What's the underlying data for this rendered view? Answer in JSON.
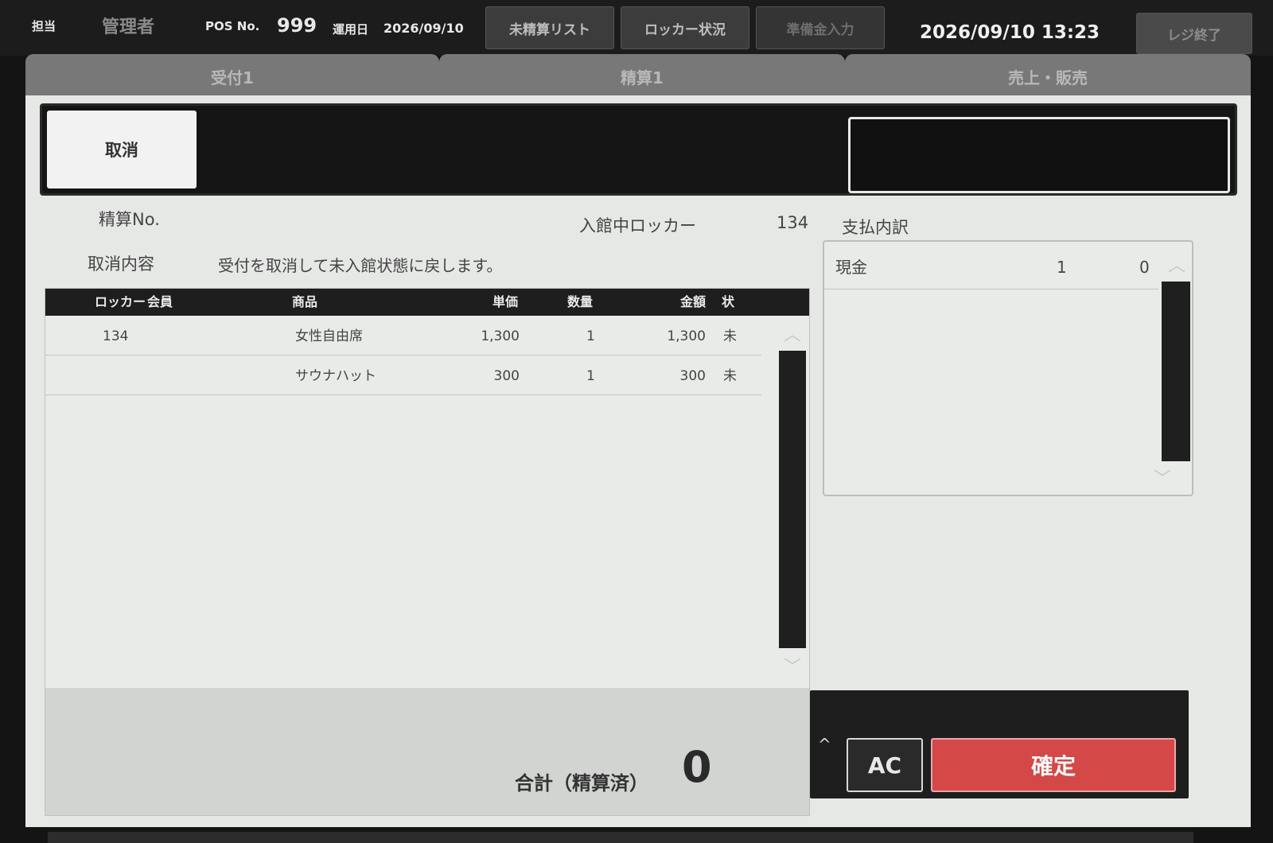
{
  "topbar": {
    "operator_label": "担当",
    "operator_name": "管理者",
    "pos_label": "POS No.",
    "pos_no": "999",
    "biz_date_label": "運用日",
    "biz_date": "2026/09/10",
    "btn_unsettled": "未精算リスト",
    "btn_locker": "ロッカー状況",
    "btn_reserve": "準備金入力",
    "clock": "2026/09/10 13:23",
    "btn_close": "レジ終了"
  },
  "tabs": [
    "受付1",
    "精算1",
    "売上・販売"
  ],
  "action": {
    "cancel_label": "取消"
  },
  "info": {
    "settle_no_label": "精算No.",
    "locker_label": "入館中ロッカー",
    "locker_value": "134",
    "payment_label": "支払内訳",
    "cancel_detail_label": "取消内容",
    "cancel_detail_text": "受付を取消して未入館状態に戻します。"
  },
  "items": {
    "headers": {
      "locker": "ロッカー",
      "member": "会員",
      "product": "商品",
      "unit": "単価",
      "qty": "数量",
      "amount": "金額",
      "status": "状"
    },
    "rows": [
      {
        "locker": "134",
        "product": "女性自由席",
        "unit": "1,300",
        "qty": "1",
        "amount": "1,300",
        "status": "未"
      },
      {
        "locker": "",
        "product": "サウナハット",
        "unit": "300",
        "qty": "1",
        "amount": "300",
        "status": "未"
      }
    ],
    "total_label": "合計（精算済）",
    "total_value": "0"
  },
  "payments": [
    {
      "method": "現金",
      "count": "1",
      "amount": "0"
    }
  ],
  "confirm": {
    "caret": "^",
    "ac_label": "AC",
    "ok_label": "確定"
  },
  "colors": {
    "confirm_red": "#d44848",
    "bar_dark": "#1c1c1c",
    "panel": "#e6e8e6"
  }
}
